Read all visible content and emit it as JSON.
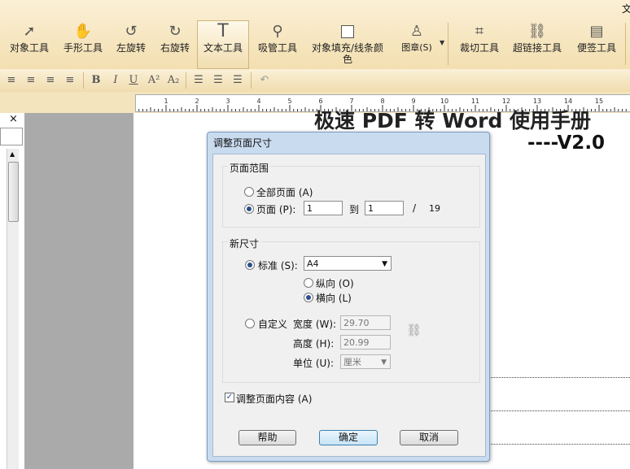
{
  "toolbar": {
    "tools": [
      "对象工具",
      "手形工具",
      "左旋转",
      "右旋转",
      "文本工具",
      "吸管工具",
      "对象填充/线条颜",
      "色",
      "图章(S)",
      "裁切工具",
      "超链接工具",
      "便签工具"
    ],
    "top_right_char": "文"
  },
  "format_bar": {
    "bold": "B",
    "italic": "I",
    "underline": "U",
    "superscript": "A²",
    "subscript": "A₂"
  },
  "ruler": {
    "labels": [
      "1",
      "2",
      "3",
      "4",
      "5",
      "6",
      "7",
      "8",
      "9",
      "10",
      "11",
      "12",
      "13",
      "14",
      "15"
    ]
  },
  "document": {
    "title_partial": "极速 PDF 转 Word 使用手册",
    "version": "----V2.0"
  },
  "left_panel": {
    "close": "×"
  },
  "dialog": {
    "title": "调整页面尺寸",
    "page_range": {
      "group_label": "页面范围",
      "all_pages": "全部页面 (A)",
      "pages": "页面 (P):",
      "from": "1",
      "to_label": "到",
      "to": "1",
      "slash": "/",
      "total": "19"
    },
    "new_size": {
      "group_label": "新尺寸",
      "standard": "标准 (S):",
      "standard_value": "A4",
      "portrait": "纵向 (O)",
      "landscape": "横向 (L)",
      "custom": "自定义",
      "width_label": "宽度 (W):",
      "width": "29.70",
      "height_label": "高度 (H):",
      "height": "20.99",
      "unit_label": "单位 (U):",
      "unit": "厘米"
    },
    "adjust_content": "调整页面内容 (A)",
    "buttons": {
      "help": "帮助",
      "ok": "确定",
      "cancel": "取消"
    }
  }
}
